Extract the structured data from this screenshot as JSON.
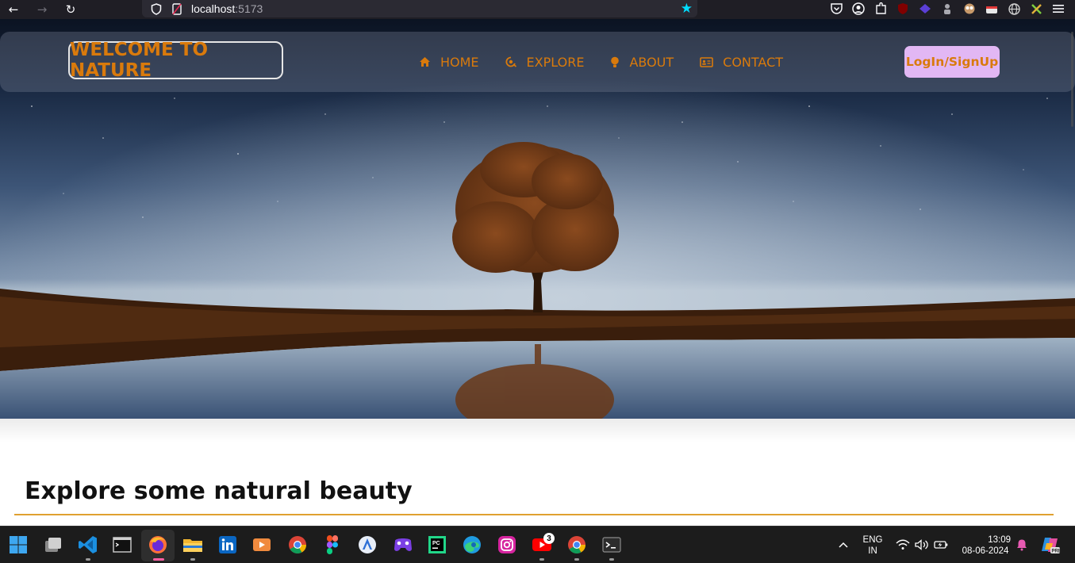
{
  "browser": {
    "url_host": "localhost",
    "url_port": ":5173"
  },
  "navbar": {
    "brand": "WELCOME TO NATURE",
    "links": [
      {
        "label": "HOME",
        "icon": "home-icon"
      },
      {
        "label": "EXPLORE",
        "icon": "explore-icon"
      },
      {
        "label": "ABOUT",
        "icon": "bulb-icon"
      },
      {
        "label": "CONTACT",
        "icon": "contact-card-icon"
      }
    ],
    "login_label": "LogIn/SignUp"
  },
  "main": {
    "section_title": "Explore some natural beauty"
  },
  "colors": {
    "accent": "#d97a0c",
    "login_bg": "#e2b7f4",
    "rule": "#e0a030"
  },
  "taskbar": {
    "apps": [
      "windows-start",
      "task-view",
      "vscode",
      "terminal",
      "firefox",
      "file-explorer",
      "linkedin",
      "media-player",
      "chrome",
      "figma",
      "app-store",
      "game-pass",
      "pycharm",
      "edge",
      "instagram",
      "youtube",
      "chrome-profile",
      "windows-terminal"
    ],
    "youtube_badge": "3",
    "language_line1": "ENG",
    "language_line2": "IN",
    "time": "13:09",
    "date": "08-06-2024"
  }
}
